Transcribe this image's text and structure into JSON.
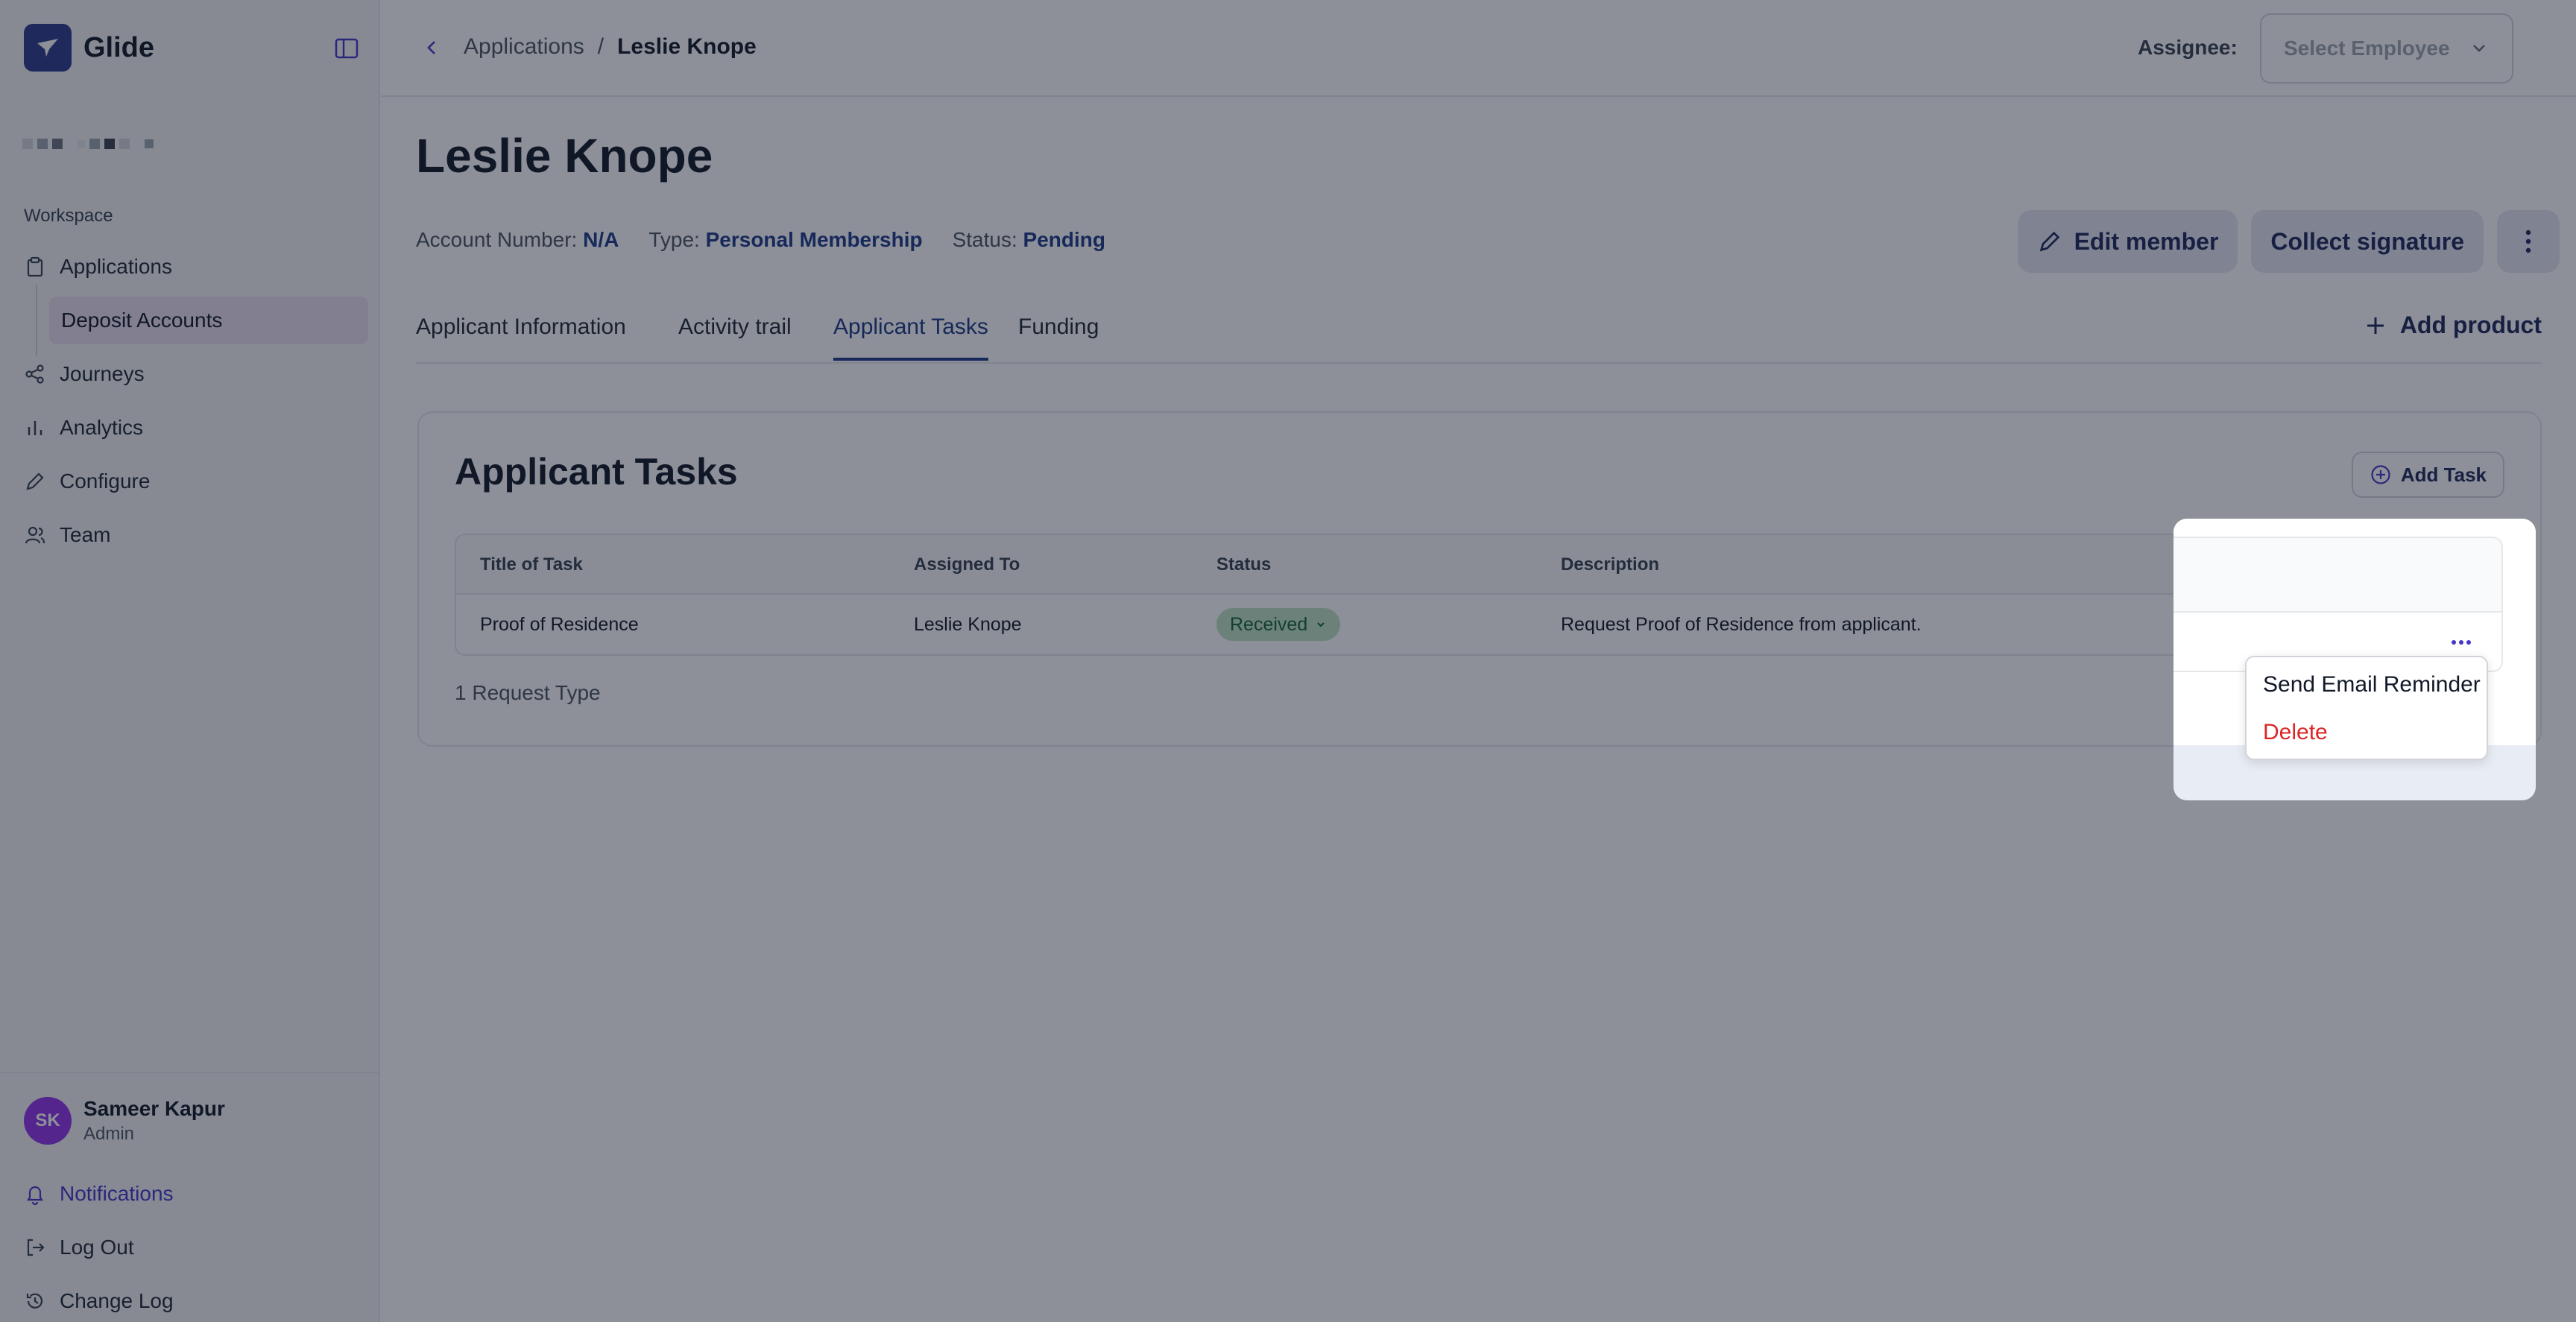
{
  "app": {
    "name": "Glide"
  },
  "sidebar": {
    "workspace_label": "Workspace",
    "items": [
      {
        "label": "Applications",
        "icon": "clipboard-icon"
      },
      {
        "label": "Deposit Accounts",
        "icon": ""
      },
      {
        "label": "Journeys",
        "icon": "share-icon"
      },
      {
        "label": "Analytics",
        "icon": "bar-chart-icon"
      },
      {
        "label": "Configure",
        "icon": "pencil-icon"
      },
      {
        "label": "Team",
        "icon": "users-icon"
      }
    ],
    "user": {
      "initials": "SK",
      "name": "Sameer Kapur",
      "role": "Admin"
    },
    "bottom_items": [
      {
        "label": "Notifications",
        "icon": "bell-icon"
      },
      {
        "label": "Log Out",
        "icon": "logout-icon"
      },
      {
        "label": "Change Log",
        "icon": "history-icon"
      }
    ]
  },
  "header": {
    "breadcrumb": {
      "parent": "Applications",
      "separator": "/",
      "current": "Leslie Knope"
    },
    "assignee_label": "Assignee:",
    "assignee_select": "Select Employee"
  },
  "member": {
    "name": "Leslie Knope",
    "account_number_label": "Account Number:",
    "account_number": "N/A",
    "type_label": "Type:",
    "type": "Personal Membership",
    "status_label": "Status:",
    "status": "Pending"
  },
  "actions": {
    "edit": "Edit member",
    "collect": "Collect signature"
  },
  "tabs": [
    {
      "label": "Applicant Information"
    },
    {
      "label": "Activity trail"
    },
    {
      "label": "Applicant Tasks"
    },
    {
      "label": "Funding"
    }
  ],
  "add_product": "Add product",
  "tasks_card": {
    "title": "Applicant Tasks",
    "add_task": "Add Task",
    "columns": [
      "Title of Task",
      "Assigned To",
      "Status",
      "Description"
    ],
    "rows": [
      {
        "title": "Proof of Residence",
        "assigned_to": "Leslie Knope",
        "status": "Received",
        "description": "Request Proof of Residence from applicant."
      }
    ],
    "footer": "1 Request Type"
  },
  "row_menu": {
    "send_email": "Send Email Reminder",
    "delete": "Delete"
  },
  "colors": {
    "brand": "#2d3a8c",
    "accent": "#1e3a8a",
    "danger": "#dc2626",
    "success_bg": "#bfe3c6"
  }
}
